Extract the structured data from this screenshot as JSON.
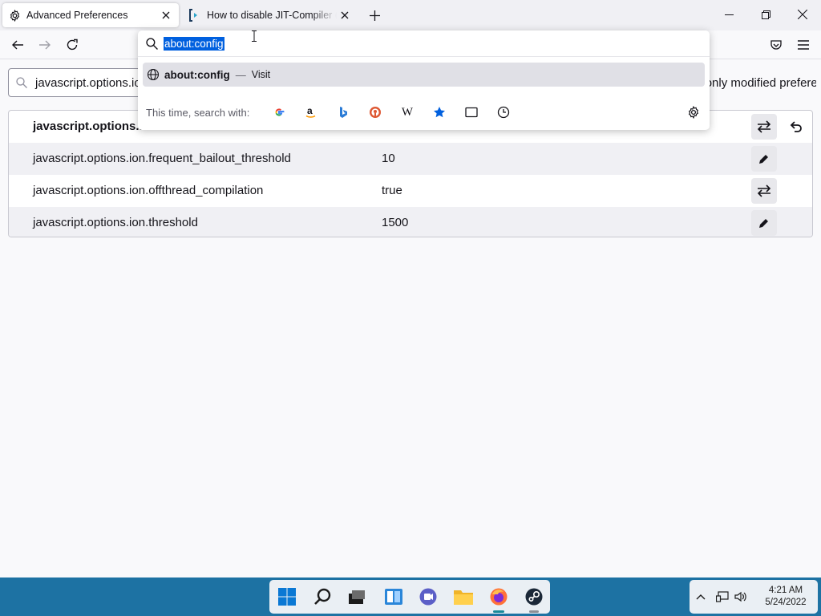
{
  "tabs": [
    {
      "title": "Advanced Preferences",
      "icon": "gear-icon",
      "active": true
    },
    {
      "title": "How to disable JIT-Compiler (Ju",
      "icon": "site-favicon",
      "active": false
    }
  ],
  "urlbar": {
    "value": "about:config",
    "suggestion": {
      "title": "about:config",
      "separator": "—",
      "action": "Visit"
    },
    "oneoff_label": "This time, search with:",
    "engines": [
      "google-icon",
      "amazon-icon",
      "bing-icon",
      "duckduckgo-icon",
      "wikipedia-icon",
      "bookmarks-icon",
      "tabs-icon",
      "history-icon"
    ],
    "wikipedia_glyph": "W"
  },
  "prefs": {
    "search_value": "javascript.options.ion",
    "show_modified": "Show only modified preferences",
    "rows": [
      {
        "name": "javascript.options.ion",
        "value": "",
        "action": "toggle",
        "modified": true
      },
      {
        "name": "javascript.options.ion.frequent_bailout_threshold",
        "value": "10",
        "action": "edit",
        "modified": false
      },
      {
        "name": "javascript.options.ion.offthread_compilation",
        "value": "true",
        "action": "toggle",
        "modified": false
      },
      {
        "name": "javascript.options.ion.threshold",
        "value": "1500",
        "action": "edit",
        "modified": false
      }
    ]
  },
  "taskbar": {
    "apps": [
      "windows-start-icon",
      "search-icon",
      "task-view-icon",
      "widgets-icon",
      "teams-chat-icon",
      "file-explorer-icon",
      "firefox-icon",
      "steam-icon"
    ],
    "time": "4:21 AM",
    "date": "5/24/2022"
  },
  "colors": {
    "accent": "#0060df",
    "taskbar": "#1d72a3"
  }
}
